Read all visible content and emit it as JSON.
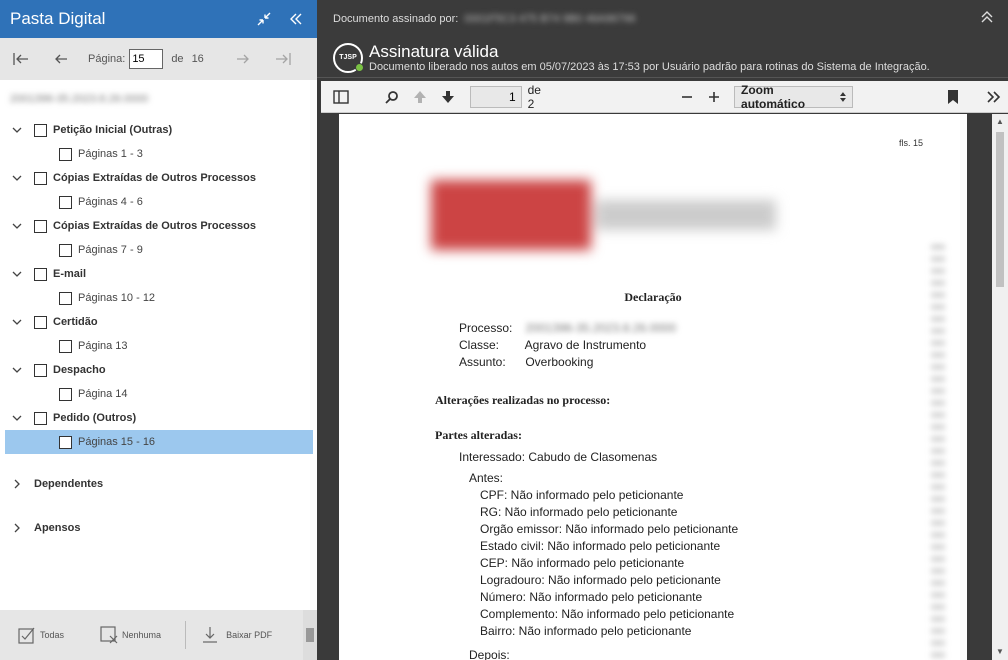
{
  "left_panel": {
    "title": "Pasta Digital",
    "pager": {
      "page_label": "Página:",
      "current_page": "15",
      "of_label": "de",
      "total_pages": "16"
    },
    "process_number": "2001396-35.2023.8.26.0000",
    "tree": [
      {
        "label": "Petição Inicial (Outras)",
        "pages": "Páginas 1 - 3"
      },
      {
        "label": "Cópias Extraídas de Outros Processos",
        "pages": "Páginas 4 - 6"
      },
      {
        "label": "Cópias Extraídas de Outros Processos",
        "pages": "Páginas 7 - 9"
      },
      {
        "label": "E-mail",
        "pages": "Páginas 10 - 12"
      },
      {
        "label": "Certidão",
        "pages": "Página 13"
      },
      {
        "label": "Despacho",
        "pages": "Página 14"
      },
      {
        "label": "Pedido (Outros)",
        "pages": "Páginas 15 - 16"
      }
    ],
    "extra": [
      "Dependentes",
      "Apensos"
    ],
    "bottom": {
      "all": "Todas",
      "none": "Nenhuma",
      "download": "Baixar PDF"
    }
  },
  "signature": {
    "signed_by_label": "Documento assinado por:",
    "signed_by_value": "0001F5C3 475 B74 9B0 46A96796",
    "status_title": "Assinatura válida",
    "status_detail": "Documento liberado nos autos em 05/07/2023 às 17:53 por Usuário padrão para rotinas do Sistema de Integração.",
    "seal_text": "TJSP",
    "seal_subtext": "SAJ"
  },
  "pdf_toolbar": {
    "page_value": "1",
    "of_pages": "de 2",
    "zoom": "Zoom automático"
  },
  "document": {
    "fls": "fls. 15",
    "title": "Declaração",
    "fields": [
      {
        "key": "Processo:",
        "value": "2001396-35.2023.8.26.0000"
      },
      {
        "key": "Classe:",
        "value": "Agravo de Instrumento"
      },
      {
        "key": "Assunto:",
        "value": "Overbooking"
      }
    ],
    "section1": "Alterações realizadas no processo:",
    "section2": "Partes alteradas:",
    "interessado": "Interessado: Cabudo de Clasomenas",
    "antes": "Antes:",
    "items": [
      "CPF: Não informado pelo peticionante",
      "RG: Não informado pelo peticionante",
      "Orgão emissor: Não informado pelo peticionante",
      "Estado civil: Não informado pelo peticionante",
      "CEP: Não informado pelo peticionante",
      "Logradouro: Não informado pelo peticionante",
      "Número: Não informado pelo peticionante",
      "Complemento: Não informado pelo peticionante",
      "Bairro: Não informado pelo peticionante"
    ],
    "depois": "Depois:"
  }
}
